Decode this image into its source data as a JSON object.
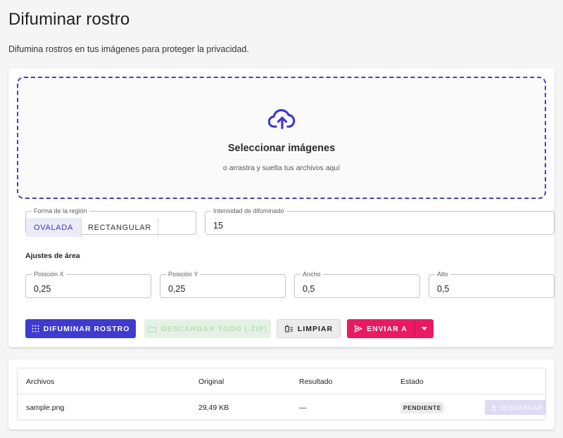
{
  "header": {
    "title": "Difuminar rostro",
    "subtitle": "Difumina rostros en tus imágenes para proteger la privacidad."
  },
  "dropzone": {
    "title": "Seleccionar imágenes",
    "hint": "o arrastra y suelta tus archivos aquí",
    "icon": "cloud-upload-icon"
  },
  "options": {
    "shape_legend": "Forma de la región",
    "shape_options": [
      "OVALADA",
      "RECTANGULAR"
    ],
    "shape_selected": "OVALADA",
    "intensity_legend": "Intensidad de difuminado",
    "intensity_value": "15"
  },
  "area": {
    "label": "Ajustes de área",
    "pos_x_legend": "Posición X",
    "pos_x_value": "0,25",
    "pos_y_legend": "Posición Y",
    "pos_y_value": "0,25",
    "width_legend": "Ancho",
    "width_value": "0,5",
    "height_legend": "Alto",
    "height_value": "0,5"
  },
  "actions": {
    "blur_label": "DIFUMINAR ROSTRO",
    "zip_label": "DESCARGAR TODO (.ZIP)",
    "clear_label": "LIMPIAR",
    "send_label": "ENVIAR A"
  },
  "files": {
    "columns": [
      "Archivos",
      "Original",
      "Resultado",
      "Estado"
    ],
    "rows": [
      {
        "name": "sample.png",
        "original": "29,49 KB",
        "result": "—",
        "status": "PENDIENTE",
        "download_label": "DESCARGAR"
      }
    ]
  },
  "colors": {
    "primary": "#3f3ad0",
    "accent": "#e91a62",
    "dropzone_border": "#4540c4"
  }
}
